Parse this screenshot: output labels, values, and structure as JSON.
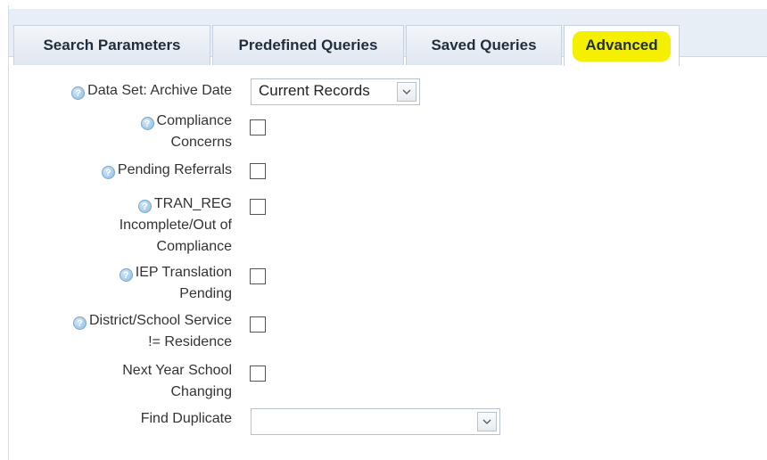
{
  "tabs": [
    {
      "label": "Search Parameters"
    },
    {
      "label": "Predefined Queries"
    },
    {
      "label": "Saved Queries"
    },
    {
      "label": "Advanced",
      "active": true,
      "highlight_color": "#f4f000"
    }
  ],
  "fields": {
    "data_set": {
      "label": "Data Set: Archive Date",
      "value": "Current Records",
      "icon": "help-icon"
    },
    "compliance": {
      "line1": "Compliance",
      "line2": "Concerns",
      "icon": "help-icon",
      "checked": false
    },
    "pending_referrals": {
      "label": "Pending Referrals",
      "icon": "help-icon",
      "checked": false
    },
    "tran_reg": {
      "line1": "TRAN_REG",
      "line2": "Incomplete/Out of",
      "line3": "Compliance",
      "icon": "help-icon",
      "checked": false
    },
    "iep": {
      "line1": "IEP Translation",
      "line2": "Pending",
      "icon": "help-icon",
      "checked": false
    },
    "district": {
      "line1": "District/School Service",
      "line2": "!= Residence",
      "icon": "help-icon",
      "checked": false
    },
    "next_year": {
      "line1": "Next Year School",
      "line2": "Changing",
      "checked": false
    },
    "find_duplicate": {
      "label": "Find Duplicate",
      "value": ""
    }
  },
  "help_glyph": "?"
}
